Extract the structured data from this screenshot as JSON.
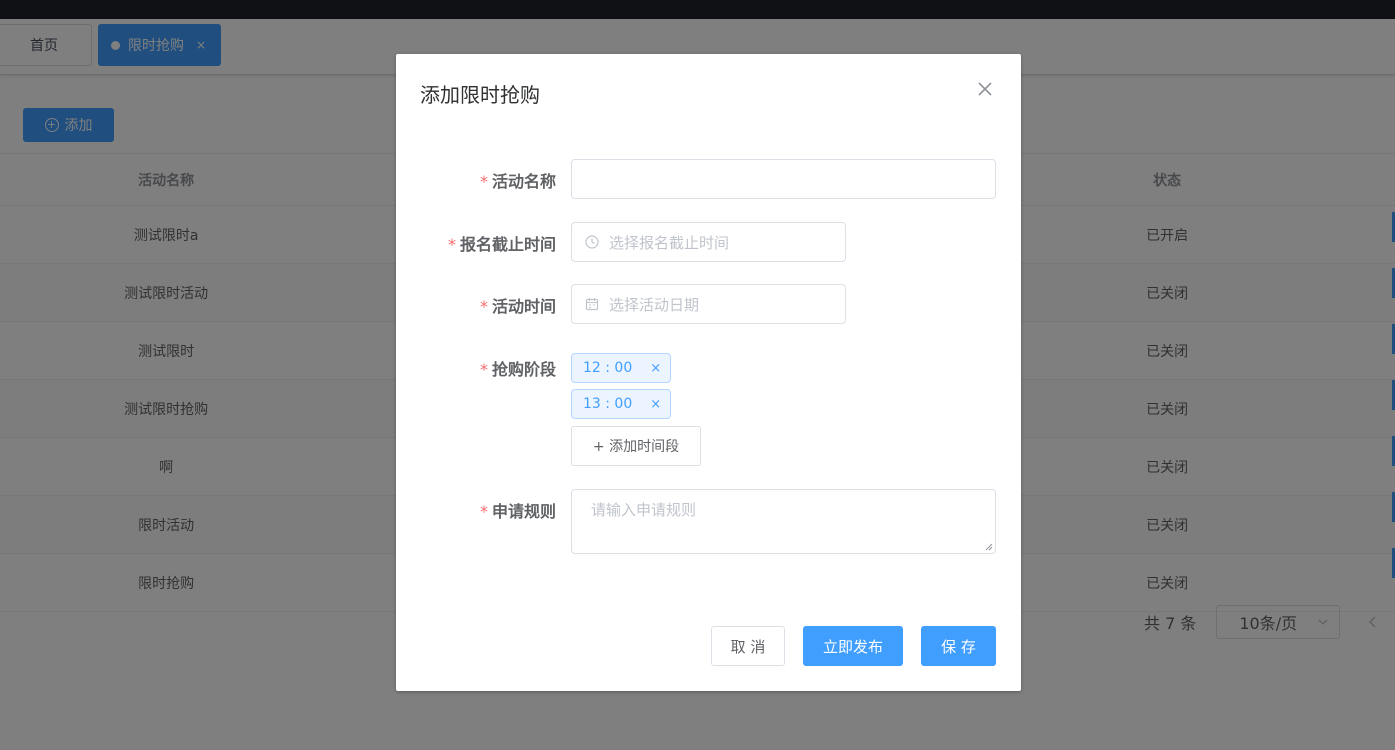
{
  "tabs": {
    "home": "首页",
    "active": "限时抢购",
    "close_glyph": "×"
  },
  "toolbar": {
    "add_label": "添加",
    "add_glyph": "+"
  },
  "table": {
    "columns": {
      "name": "活动名称",
      "status": "状态"
    },
    "rows": [
      {
        "name": "测试限时a",
        "status": "已开启"
      },
      {
        "name": "测试限时活动",
        "status": "已关闭"
      },
      {
        "name": "测试限时",
        "status": "已关闭"
      },
      {
        "name": "测试限时抢购",
        "status": "已关闭"
      },
      {
        "name": "啊",
        "status": "已关闭"
      },
      {
        "name": "限时活动",
        "status": "已关闭"
      },
      {
        "name": "限时抢购",
        "status": "已关闭"
      }
    ]
  },
  "pagination": {
    "total": "共 7 条",
    "page_size": "10条/页"
  },
  "dialog": {
    "title": "添加限时抢购",
    "required_mark": "*",
    "fields": {
      "name": {
        "label": "活动名称",
        "value": ""
      },
      "deadline": {
        "label": "报名截止时间",
        "placeholder": "选择报名截止时间"
      },
      "date": {
        "label": "活动时间",
        "placeholder": "选择活动日期"
      },
      "stages": {
        "label": "抢购阶段",
        "tags": [
          "12 : 00",
          "13 : 00"
        ],
        "add_label": "+ 添加时间段",
        "remove_glyph": "×"
      },
      "rules": {
        "label": "申请规则",
        "placeholder": "请输入申请规则"
      }
    },
    "buttons": {
      "cancel": "取 消",
      "publish": "立即发布",
      "save": "保 存"
    }
  },
  "colors": {
    "primary": "#409eff",
    "danger": "#f56c6c",
    "topbar": "#20222a"
  },
  "icons": [
    "close-icon",
    "clock-icon",
    "calendar-icon",
    "chevron-down-icon",
    "chevron-left-icon",
    "plus-circle-icon"
  ]
}
